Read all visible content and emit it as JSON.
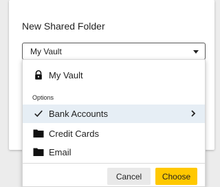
{
  "dialog": {
    "title": "New Shared Folder",
    "select_value": "My Vault"
  },
  "dropdown": {
    "top_item": {
      "label": "My Vault",
      "icon": "lock-icon"
    },
    "section_label": "Options",
    "items": [
      {
        "label": "Bank Accounts",
        "icon": "checkmark-icon",
        "selected": true,
        "has_submenu": true
      },
      {
        "label": "Credit Cards",
        "icon": "folder-icon",
        "selected": false
      },
      {
        "label": "Email",
        "icon": "folder-icon",
        "selected": false
      }
    ]
  },
  "buttons": {
    "cancel": "Cancel",
    "choose": "Choose"
  },
  "colors": {
    "accent": "#ffc800",
    "selected_row": "#e6eef5"
  }
}
